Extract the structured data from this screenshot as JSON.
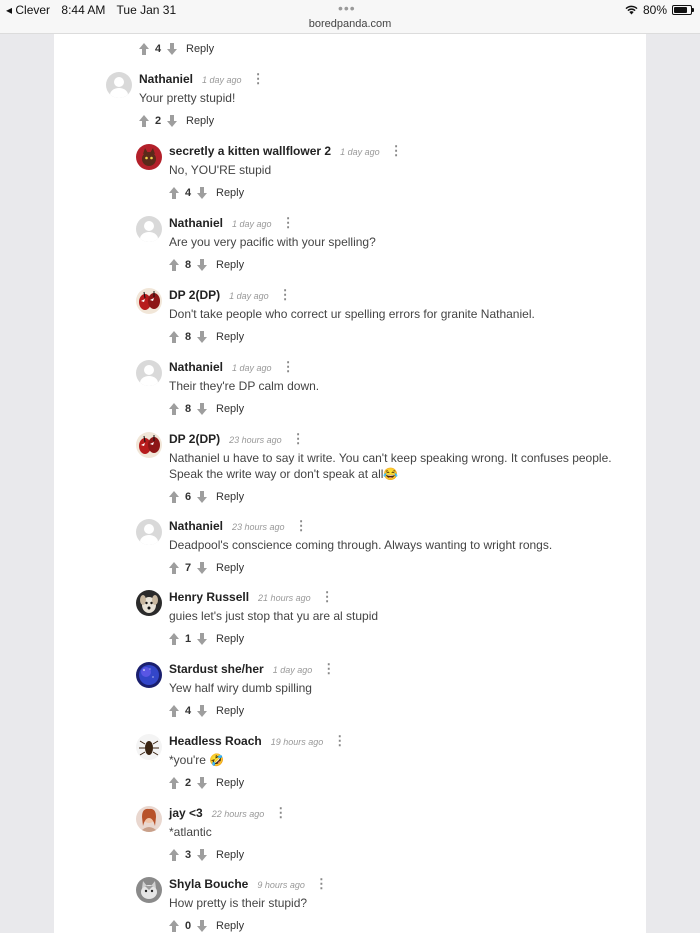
{
  "status": {
    "carrier": "◂ Clever",
    "time": "8:44 AM",
    "date": "Tue Jan 31",
    "dots": "•••",
    "url": "boredpanda.com",
    "battery": "80%",
    "battery_level": 0.8
  },
  "reply_label": "Reply",
  "top_actions": {
    "count": "4"
  },
  "comments": [
    {
      "author": "Nathaniel",
      "time": "1 day ago",
      "text": "Your pretty stupid!",
      "count": "2",
      "avatar": "default-avatar"
    },
    {
      "author": "secretly a kitten wallflower 2",
      "time": "1 day ago",
      "text": "No, YOU'RE stupid",
      "count": "4",
      "avatar": "kitten-avatar"
    },
    {
      "author": "Nathaniel",
      "time": "1 day ago",
      "text": "Are you very pacific with your spelling?",
      "count": "8",
      "avatar": "default-avatar"
    },
    {
      "author": "DP 2(DP)",
      "time": "1 day ago",
      "text": "Don't take people who correct ur spelling errors for granite Nathaniel.",
      "count": "8",
      "avatar": "deadpool-avatar"
    },
    {
      "author": "Nathaniel",
      "time": "1 day ago",
      "text": "Their they're DP calm down.",
      "count": "8",
      "avatar": "default-avatar"
    },
    {
      "author": "DP 2(DP)",
      "time": "23 hours ago",
      "text": "Nathaniel u have to say it write. You can't keep speaking wrong. It confuses people.",
      "text2": "Speak the write way or don't speak at all😂",
      "count": "6",
      "avatar": "deadpool-avatar"
    },
    {
      "author": "Nathaniel",
      "time": "23 hours ago",
      "text": "Deadpool's conscience coming through. Always wanting to wright rongs.",
      "count": "7",
      "avatar": "default-avatar"
    },
    {
      "author": "Henry Russell",
      "time": "21 hours ago",
      "text": "guies let's just stop that yu are al stupid",
      "count": "1",
      "avatar": "dog-avatar"
    },
    {
      "author": "Stardust she/her",
      "time": "1 day ago",
      "text": "Yew half wiry dumb spilling",
      "count": "4",
      "avatar": "galaxy-avatar"
    },
    {
      "author": "Headless Roach",
      "time": "19 hours ago",
      "text": "*you're 🤣",
      "count": "2",
      "avatar": "roach-avatar"
    },
    {
      "author": "jay <3",
      "time": "22 hours ago",
      "text": "*atlantic",
      "count": "3",
      "avatar": "person-avatar"
    },
    {
      "author": "Shyla Bouche",
      "time": "9 hours ago",
      "text": "How pretty is their stupid?",
      "count": "0",
      "avatar": "cat-avatar"
    }
  ]
}
